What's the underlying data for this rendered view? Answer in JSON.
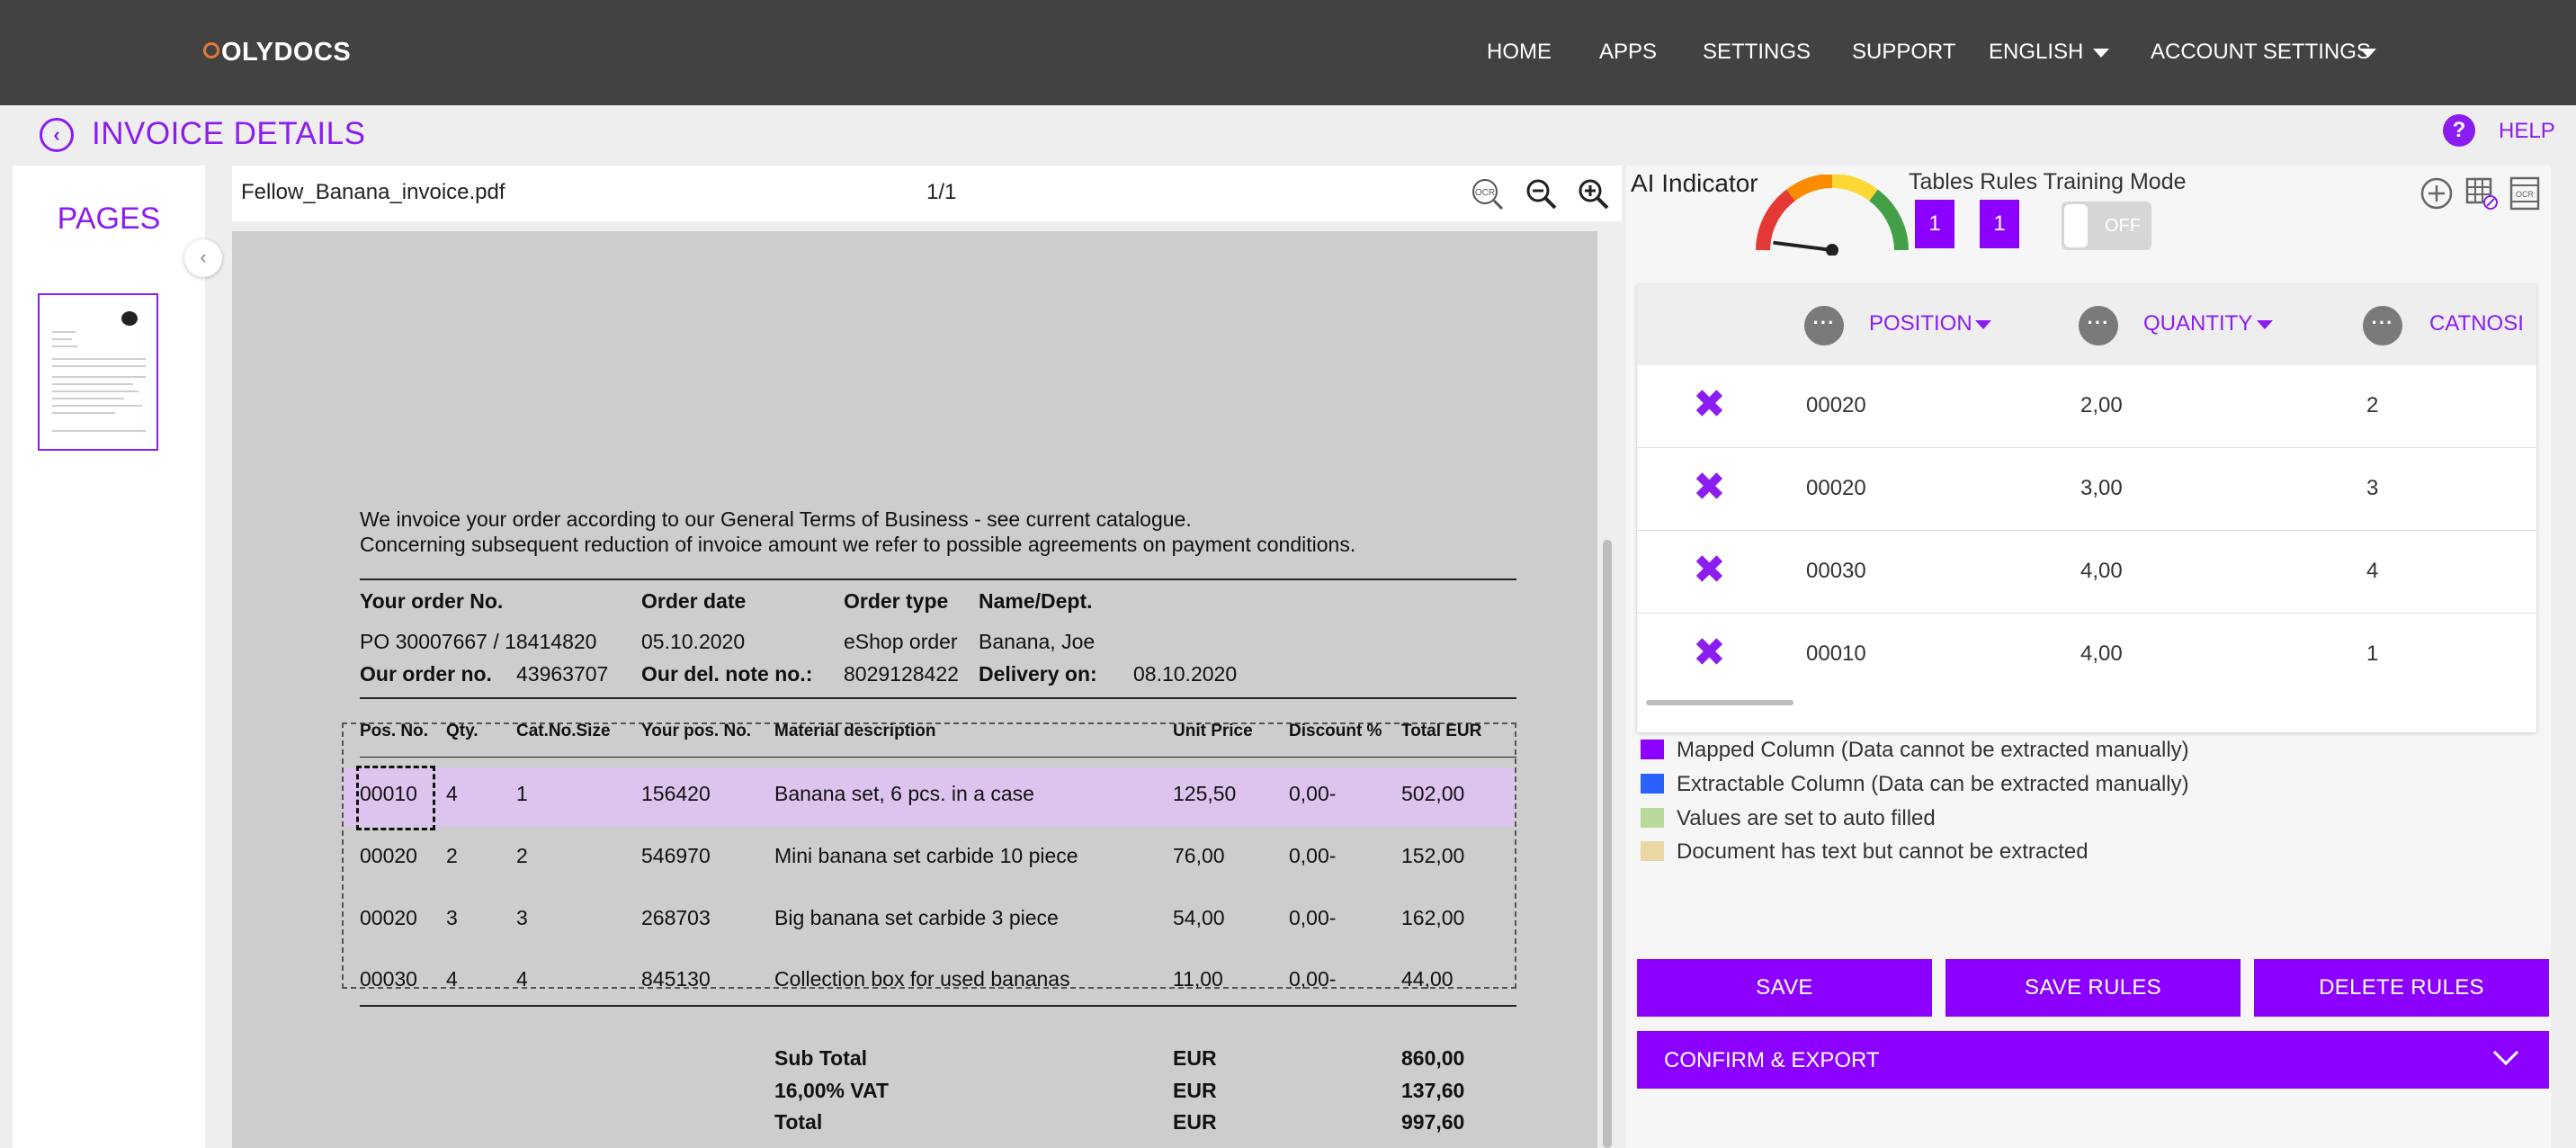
{
  "nav": {
    "logo": "OLYDOCS",
    "items": [
      "HOME",
      "APPS",
      "SETTINGS",
      "SUPPORT"
    ],
    "language": "ENGLISH",
    "account": "ACCOUNT SETTINGS"
  },
  "header": {
    "title": "INVOICE DETAILS",
    "help": "HELP"
  },
  "pages_panel": {
    "title": "PAGES"
  },
  "viewer": {
    "filename": "Fellow_Banana_invoice.pdf",
    "page_count": "1/1",
    "icons": [
      "ocr-icon",
      "zoom-out-icon",
      "zoom-in-icon"
    ]
  },
  "document": {
    "line1": "We invoice your order according to our General Terms of Business - see current catalogue.",
    "line2": "Concerning subsequent reduction of invoice amount we refer to possible agreements on payment conditions.",
    "order_labels": [
      "Your order No.",
      "Order date",
      "Order type",
      "Name/Dept."
    ],
    "order_values": [
      "PO 30007667 / 18414820",
      "05.10.2020",
      "eShop order",
      "Banana, Joe"
    ],
    "our_order_label": "Our order no.",
    "our_order_value": "43963707",
    "del_note_label": "Our del. note no.:",
    "del_note_value": "8029128422",
    "delivery_label": "Delivery on:",
    "delivery_value": "08.10.2020",
    "table_headers": [
      "Pos. No.",
      "Qty.",
      "Cat.No.Size",
      "Your pos. No.",
      "Material description",
      "Unit Price",
      "Discount %",
      "Total EUR"
    ],
    "table_rows": [
      [
        "00010",
        "4",
        "1",
        "156420",
        "Banana set, 6 pcs. in a case",
        "125,50",
        "0,00-",
        "502,00"
      ],
      [
        "00020",
        "2",
        "2",
        "546970",
        "Mini banana set carbide 10 piece",
        "76,00",
        "0,00-",
        "152,00"
      ],
      [
        "00020",
        "3",
        "3",
        "268703",
        "Big banana set carbide 3 piece",
        "54,00",
        "0,00-",
        "162,00"
      ],
      [
        "00030",
        "4",
        "4",
        "845130",
        "Collection box for used bananas",
        "11,00",
        "0,00-",
        "44,00"
      ]
    ],
    "totals": [
      {
        "label": "Sub Total",
        "currency": "EUR",
        "value": "860,00"
      },
      {
        "label": "16,00% VAT",
        "currency": "EUR",
        "value": "137,60"
      },
      {
        "label": "Total",
        "currency": "EUR",
        "value": "997,60"
      }
    ]
  },
  "ai": {
    "label": "AI Indicator",
    "tables_rules_label": "Tables Rules",
    "training_mode_label": "Training Mode",
    "tables_value": "1",
    "rules_value": "1",
    "toggle_state": "OFF",
    "gauge_level": 0.04
  },
  "grid": {
    "columns": [
      "POSITION",
      "QUANTITY",
      "CATNOSI"
    ],
    "rows": [
      [
        "00020",
        "2,00",
        "2"
      ],
      [
        "00020",
        "3,00",
        "3"
      ],
      [
        "00030",
        "4,00",
        "4"
      ],
      [
        "00010",
        "4,00",
        "1"
      ]
    ]
  },
  "legend": [
    {
      "label": "Mapped Column (Data cannot be extracted manually)",
      "color": "#8b00ff"
    },
    {
      "label": "Extractable Column (Data can be extracted manually)",
      "color": "#2962ff"
    },
    {
      "label": "Values are set to auto filled",
      "color": "#b9d99a"
    },
    {
      "label": "Document has text but cannot be extracted",
      "color": "#ead7a3"
    }
  ],
  "actions": {
    "save": "SAVE",
    "save_rules": "SAVE RULES",
    "delete_rules": "DELETE RULES",
    "confirm_export": "CONFIRM & EXPORT"
  },
  "colors": {
    "accent": "#8b00ff",
    "topbar": "#424242"
  }
}
